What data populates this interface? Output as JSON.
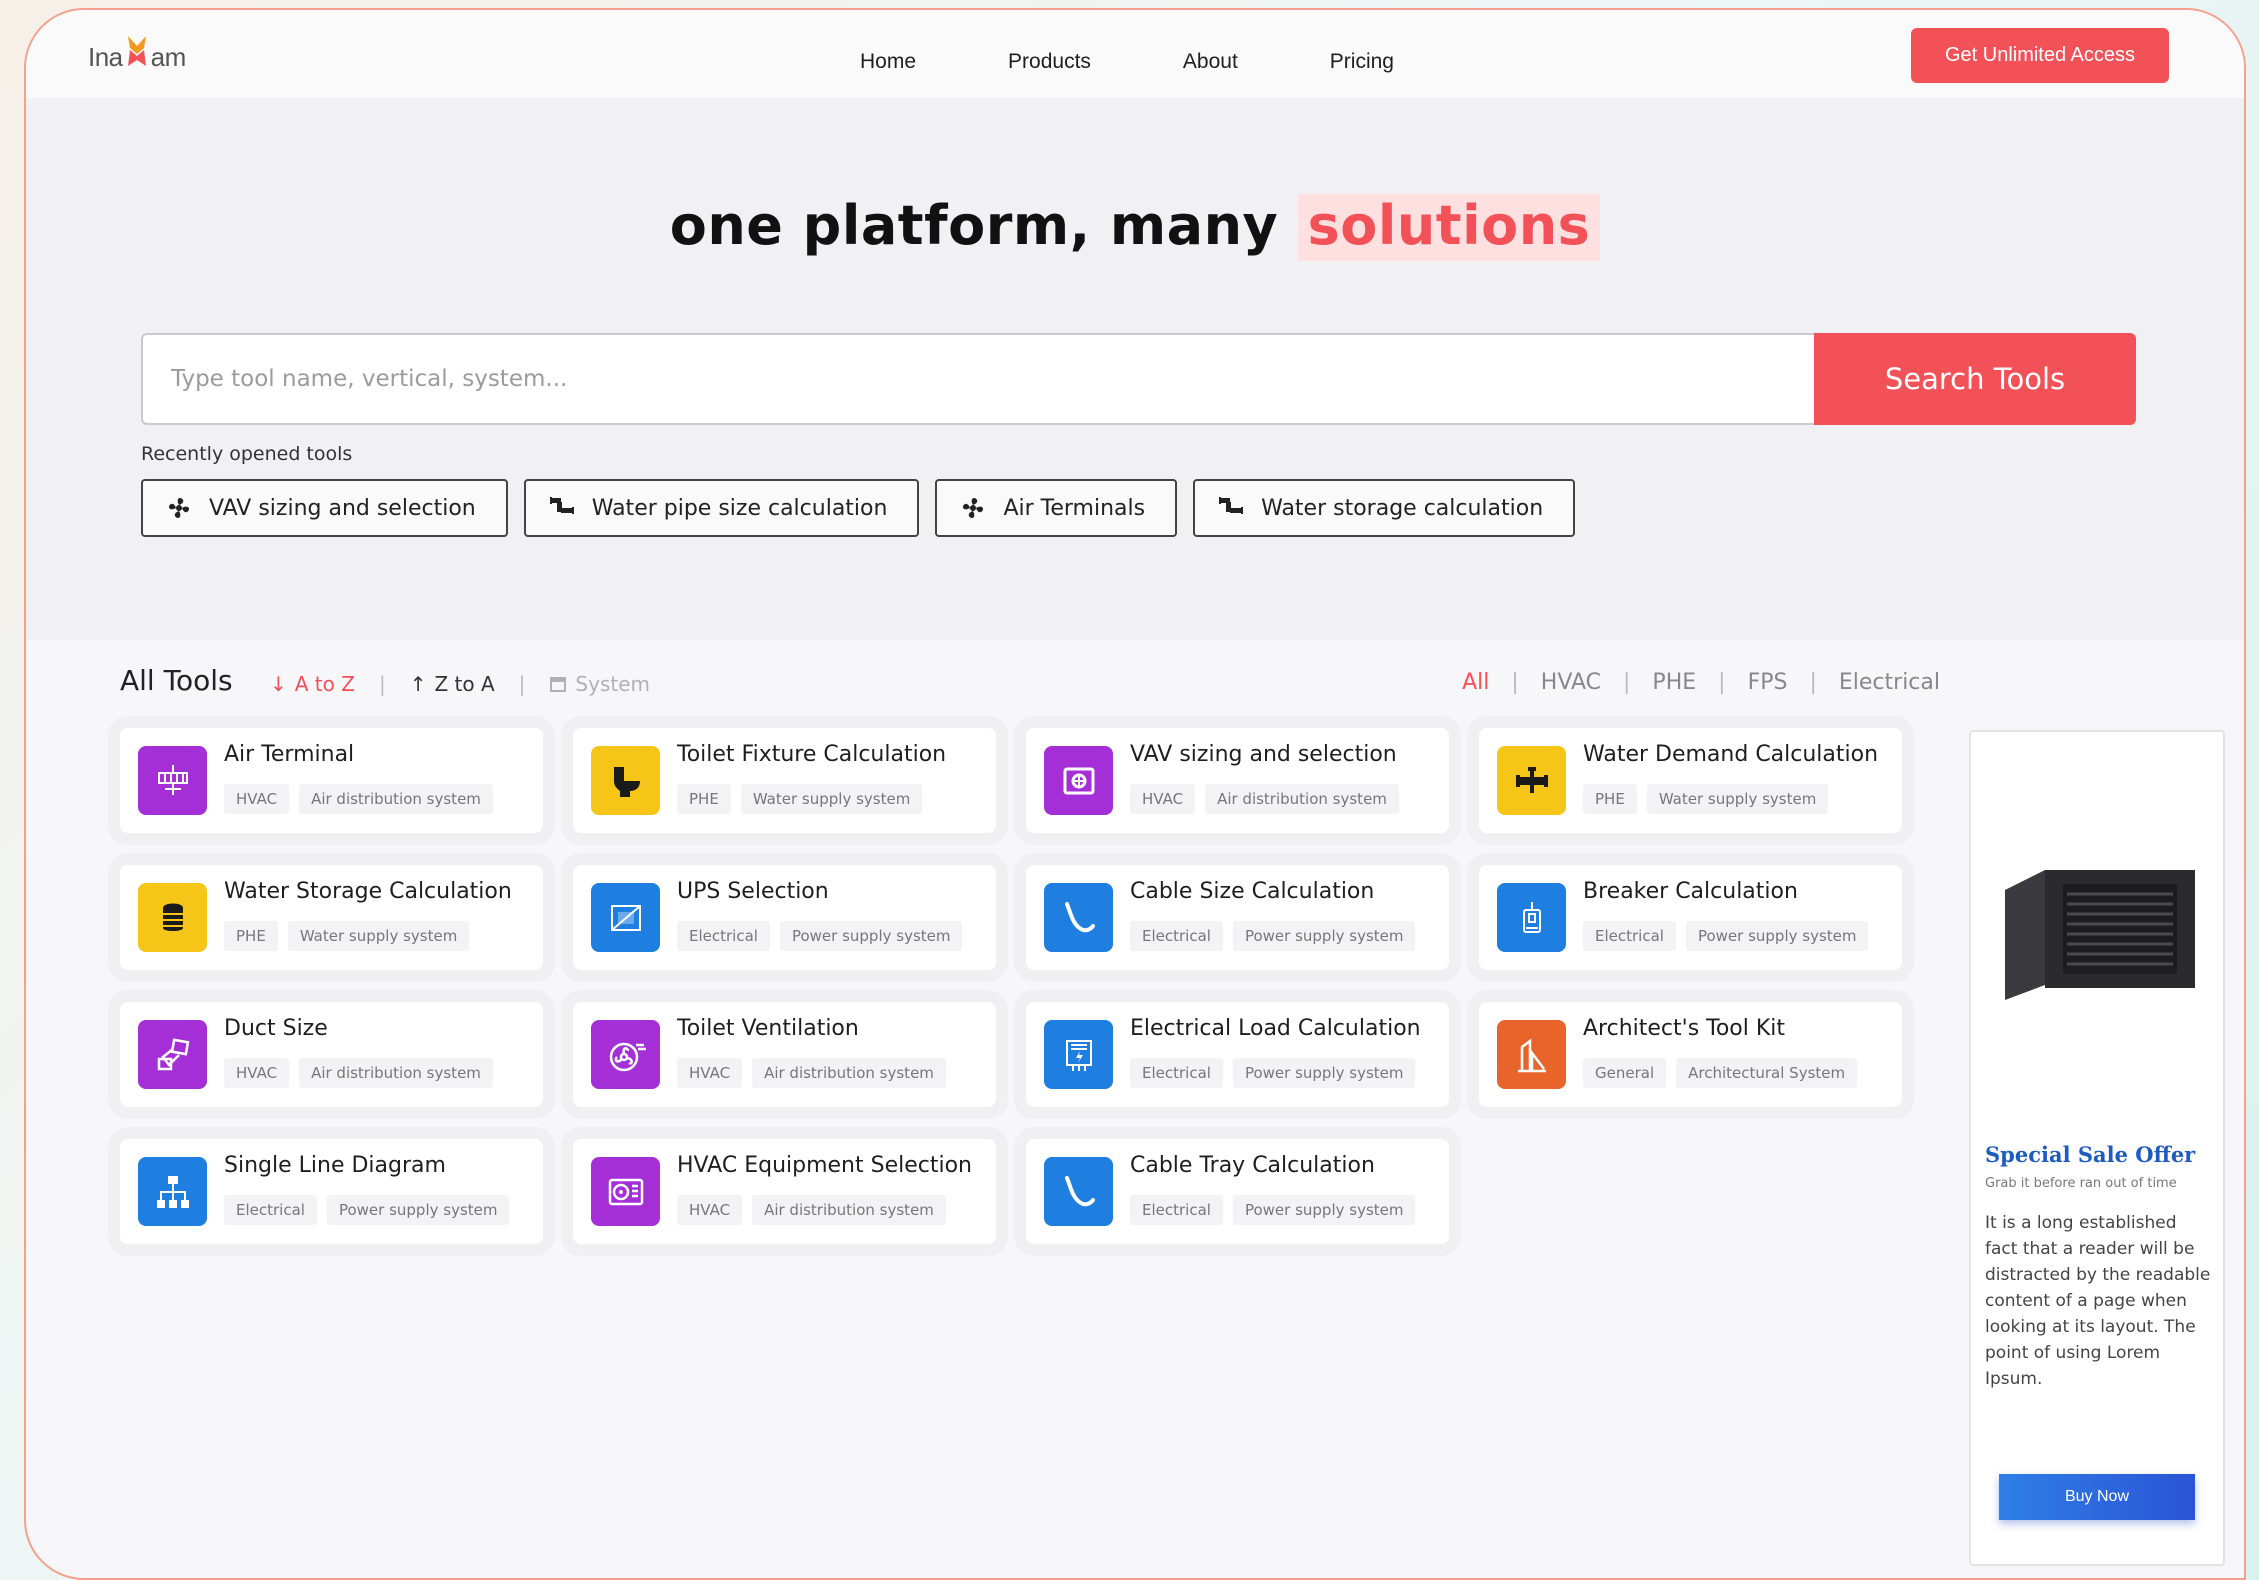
{
  "header": {
    "logo_text_left": "Ina",
    "logo_text_right": "am",
    "nav": [
      "Home",
      "Products",
      "About",
      "Pricing"
    ],
    "cta": "Get Unlimited Access"
  },
  "hero": {
    "headline_main": "one platform, many",
    "headline_highlight": "solutions",
    "search_placeholder": "Type tool name, vertical, system...",
    "search_button": "Search Tools",
    "recent_label": "Recently opened tools",
    "recent": [
      {
        "label": "VAV sizing and selection",
        "icon": "fan-icon"
      },
      {
        "label": "Water pipe size calculation",
        "icon": "pipe-icon"
      },
      {
        "label": "Air Terminals",
        "icon": "fan-icon"
      },
      {
        "label": "Water storage calculation",
        "icon": "pipe-icon"
      }
    ]
  },
  "tools": {
    "title": "All Tools",
    "sort": [
      "A to Z",
      "Z to A",
      "System"
    ],
    "filters": [
      "All",
      "HVAC",
      "PHE",
      "FPS",
      "Electrical"
    ],
    "items": [
      {
        "name": "Air Terminal",
        "tags": [
          "HVAC",
          "Air distribution system"
        ],
        "color": "#a42fd6",
        "icon": "air-terminal-icon"
      },
      {
        "name": "Toilet Fixture Calculation",
        "tags": [
          "PHE",
          "Water supply system"
        ],
        "color": "#f5c518",
        "icon": "toilet-icon"
      },
      {
        "name": "VAV sizing and selection",
        "tags": [
          "HVAC",
          "Air distribution system"
        ],
        "color": "#a42fd6",
        "icon": "vav-box-icon"
      },
      {
        "name": "Water Demand Calculation",
        "tags": [
          "PHE",
          "Water supply system"
        ],
        "color": "#f5c518",
        "icon": "faucet-icon"
      },
      {
        "name": "Water Storage Calculation",
        "tags": [
          "PHE",
          "Water supply system"
        ],
        "color": "#f5c518",
        "icon": "water-tank-icon"
      },
      {
        "name": "UPS Selection",
        "tags": [
          "Electrical",
          "Power supply system"
        ],
        "color": "#1e7fe0",
        "icon": "ups-icon"
      },
      {
        "name": "Cable Size Calculation",
        "tags": [
          "Electrical",
          "Power supply system"
        ],
        "color": "#1e7fe0",
        "icon": "cable-icon"
      },
      {
        "name": "Breaker Calculation",
        "tags": [
          "Electrical",
          "Power supply system"
        ],
        "color": "#1e7fe0",
        "icon": "breaker-icon"
      },
      {
        "name": "Duct Size",
        "tags": [
          "HVAC",
          "Air distribution system"
        ],
        "color": "#a42fd6",
        "icon": "duct-icon"
      },
      {
        "name": "Toilet Ventilation",
        "tags": [
          "HVAC",
          "Air distribution system"
        ],
        "color": "#a42fd6",
        "icon": "ventilation-fan-icon"
      },
      {
        "name": "Electrical Load Calculation",
        "tags": [
          "Electrical",
          "Power supply system"
        ],
        "color": "#1e7fe0",
        "icon": "electrical-panel-icon"
      },
      {
        "name": "Architect's Tool Kit",
        "tags": [
          "General",
          "Architectural System"
        ],
        "color": "#e8642a",
        "icon": "architecture-icon"
      },
      {
        "name": "Single Line Diagram",
        "tags": [
          "Electrical",
          "Power supply system"
        ],
        "color": "#1e7fe0",
        "icon": "diagram-icon"
      },
      {
        "name": "HVAC Equipment Selection",
        "tags": [
          "HVAC",
          "Air distribution system"
        ],
        "color": "#a42fd6",
        "icon": "hvac-unit-icon"
      },
      {
        "name": "Cable Tray Calculation",
        "tags": [
          "Electrical",
          "Power supply system"
        ],
        "color": "#1e7fe0",
        "icon": "cable-icon"
      }
    ]
  },
  "promo": {
    "title": "Special Sale Offer",
    "subtitle": "Grab it before ran out of time",
    "body": "It is a long established fact that a reader will be distracted by the readable content of a page when looking at its layout. The point of using Lorem Ipsum.",
    "button": "Buy Now"
  },
  "colors": {
    "accent": "#f25257",
    "purple": "#a42fd6",
    "yellow": "#f5c518",
    "blue": "#1e7fe0",
    "orange": "#e8642a",
    "promo_title": "#1c5cbf"
  }
}
